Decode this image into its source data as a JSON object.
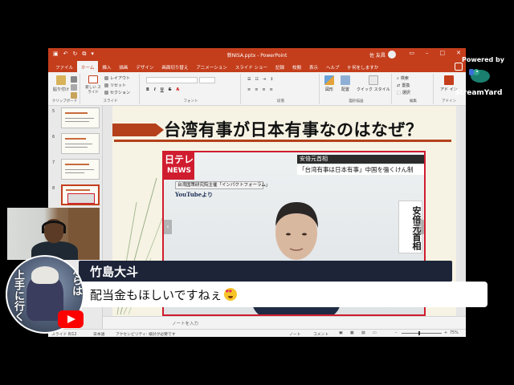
{
  "window": {
    "title": "新NISA.pptx - PowerPoint",
    "user": "佐 友昌"
  },
  "menu": {
    "tabs": [
      "ファイル",
      "ホーム",
      "挿入",
      "描画",
      "デザイン",
      "画面切り替え",
      "アニメーション",
      "スライド ショー",
      "記録",
      "校閲",
      "表示",
      "ヘルプ"
    ],
    "active_tab": "ホーム",
    "tell_me": "何をしますか"
  },
  "ribbon": {
    "groups": {
      "clipboard": "クリップボード",
      "slides": "スライド",
      "font": "フォント",
      "paragraph": "段落",
      "drawing": "図形描画",
      "editing": "編集",
      "addins": "アドイン"
    },
    "buttons": {
      "paste": "貼り付け",
      "new_slide": "新しい スライド",
      "layout": "レイアウト",
      "reset": "リセット",
      "section": "セクション",
      "shapes": "図形",
      "arrange": "配置",
      "quick_styles": "クイック スタイル",
      "find": "検索",
      "replace": "置換",
      "select": "選択",
      "addin": "アド イン"
    }
  },
  "thumbnails": [
    {
      "num": "5"
    },
    {
      "num": "6"
    },
    {
      "num": "7"
    },
    {
      "num": "8",
      "selected": true
    }
  ],
  "slide": {
    "title": "台湾有事が日本有事なのはなぜ？",
    "news": {
      "logo_line1": "日テレ",
      "logo_line2": "NEWS",
      "caption_top": "安倍元首相",
      "headline": "「台湾有事は日本有事」中国を強くけん制",
      "source": "台湾国策研究院主催「インパクトフォーラム」",
      "youtube_credit": "YouTubeより",
      "name_plate": "安倍元首相"
    }
  },
  "notes": {
    "placeholder": "ノートを入力"
  },
  "statusbar": {
    "slide_info": "スライド 8/12",
    "language": "日本語",
    "accessibility": "アクセシビリティ: 検討が必要です",
    "notes_btn": "ノート",
    "comments_btn": "コメント",
    "zoom": "75%",
    "zoom_level": 0.42
  },
  "chat": {
    "name": "竹島大斗",
    "message": "配当金もほしいですねぇ",
    "emoji": "smiling-face-with-heart-eyes"
  },
  "avatar": {
    "vertical_text": "からは",
    "vertical_text2": "上手に行く"
  },
  "branding": {
    "powered_by": "Powered by",
    "name": "StreamYard"
  },
  "colors": {
    "ppt_accent": "#c43e1c",
    "chat_name_bg": "#1d2438",
    "ntv_red": "#d01c2f"
  }
}
